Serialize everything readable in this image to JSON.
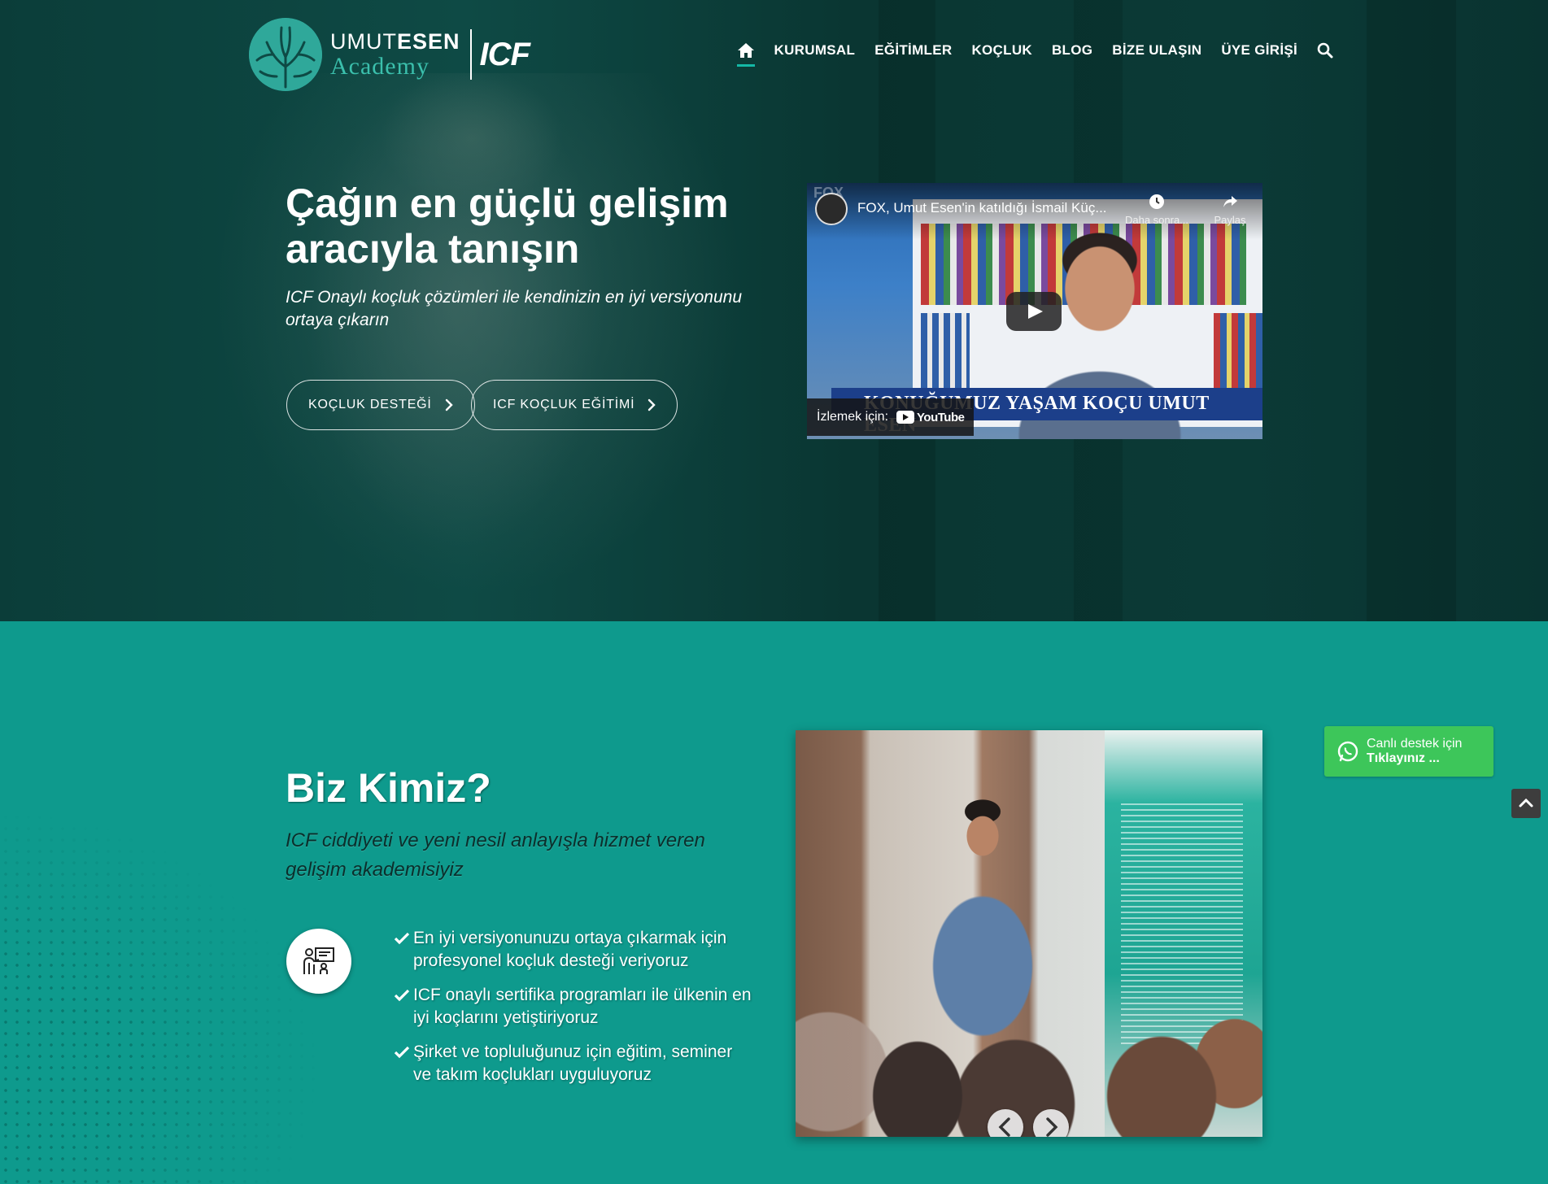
{
  "header": {
    "logo": {
      "word1_light": "UMUT",
      "word1_bold": "ESEN",
      "word2": "Academy",
      "badge": "ICF"
    },
    "nav": {
      "home_icon": "home-icon",
      "items": [
        "KURUMSAL",
        "EĞİTİMLER",
        "KOÇLUK",
        "BLOG",
        "BİZE ULAŞIN",
        "ÜYE GİRİŞİ"
      ],
      "search_icon": "search-icon"
    }
  },
  "hero": {
    "title": "Çağın en güçlü gelişim aracıyla tanışın",
    "subtitle": "ICF Onaylı koçluk çözümleri ile kendinizin en iyi versiyonunu ortaya çıkarın",
    "buttons": [
      "KOÇLUK DESTEĞİ",
      "ICF KOÇLUK EĞİTİMİ"
    ],
    "video": {
      "title": "FOX, Umut Esen'in katıldığı İsmail Küç...",
      "watch_later": "Daha sonra...",
      "share": "Paylaş",
      "lower_third": "KONUĞUMUZ YAŞAM KOÇU UMUT ESEN",
      "watch_on": "İzlemek için:",
      "youtube": "YouTube",
      "channel_mark": "FOX"
    }
  },
  "about": {
    "title": "Biz Kimiz?",
    "subtitle": "ICF ciddiyeti ve yeni nesil anlayışla hizmet veren gelişim akademisiyiz",
    "icon": "presentation-icon",
    "items": [
      "En iyi versiyonunuzu ortaya çıkarmak için profesyonel koçluk desteği veriyoruz",
      "ICF onaylı sertifika programları ile ülkenin en iyi koçlarını yetiştiriyoruz",
      "Şirket ve topluluğunuz için eğitim, seminer ve takım koçlukları uyguluyoruz"
    ]
  },
  "whatsapp": {
    "line1": "Canlı destek için",
    "line2": "Tıklayınız ..."
  },
  "colors": {
    "hero_bg": "#0b3d39",
    "section_bg": "#0e9a8d",
    "whatsapp": "#3dc65a",
    "nav_active": "#14b8a6"
  }
}
